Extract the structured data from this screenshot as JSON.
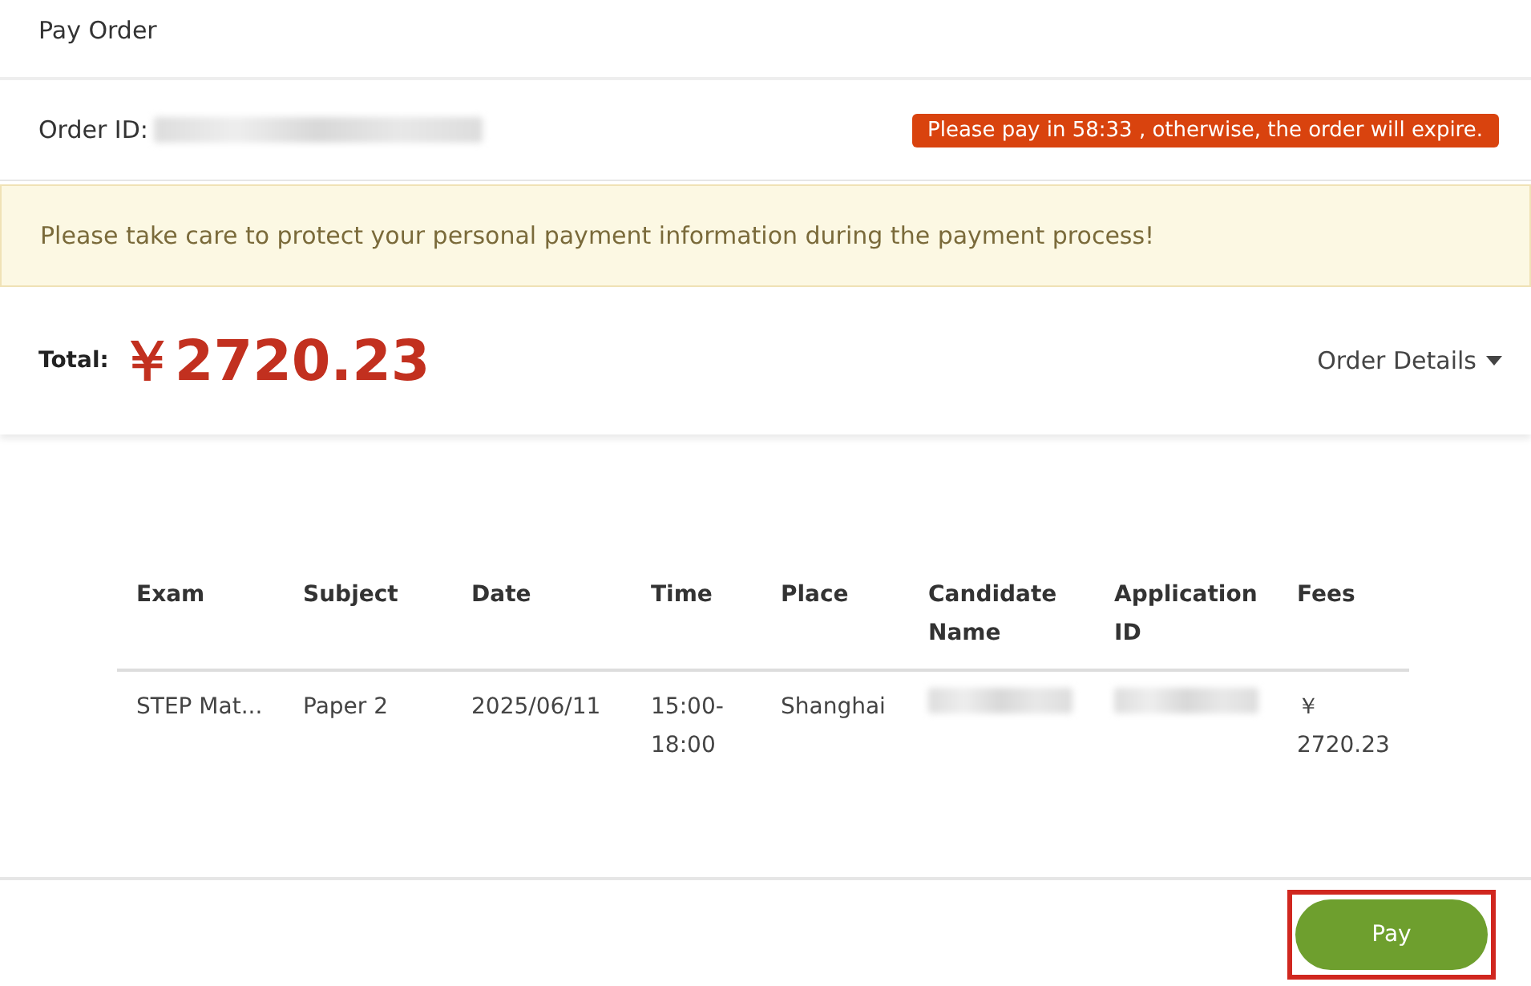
{
  "header": {
    "title": "Pay Order"
  },
  "order": {
    "label": "Order ID:",
    "redacted": true,
    "timer_notice": "Please pay in 58:33 , otherwise, the order will expire."
  },
  "notice": "Please take care to protect your personal payment information during the payment process!",
  "total": {
    "label": "Total:",
    "amount": "￥2720.23",
    "details_link": "Order Details"
  },
  "table": {
    "columns": [
      "Exam",
      "Subject",
      "Date",
      "Time",
      "Place",
      "Candidate Name",
      "Application ID",
      "Fees"
    ],
    "rows": [
      {
        "cells": [
          {
            "text": "STEP Mat..."
          },
          {
            "text": "Paper 2"
          },
          {
            "text": "2025/06/11"
          },
          {
            "text": "15:00-18:00"
          },
          {
            "text": "Shanghai"
          },
          {
            "redacted": true
          },
          {
            "redacted": true
          },
          {
            "text": "￥ 2720.23"
          }
        ]
      }
    ]
  },
  "footer": {
    "pay_button": {
      "label": "Pay",
      "highlighted": true
    }
  }
}
